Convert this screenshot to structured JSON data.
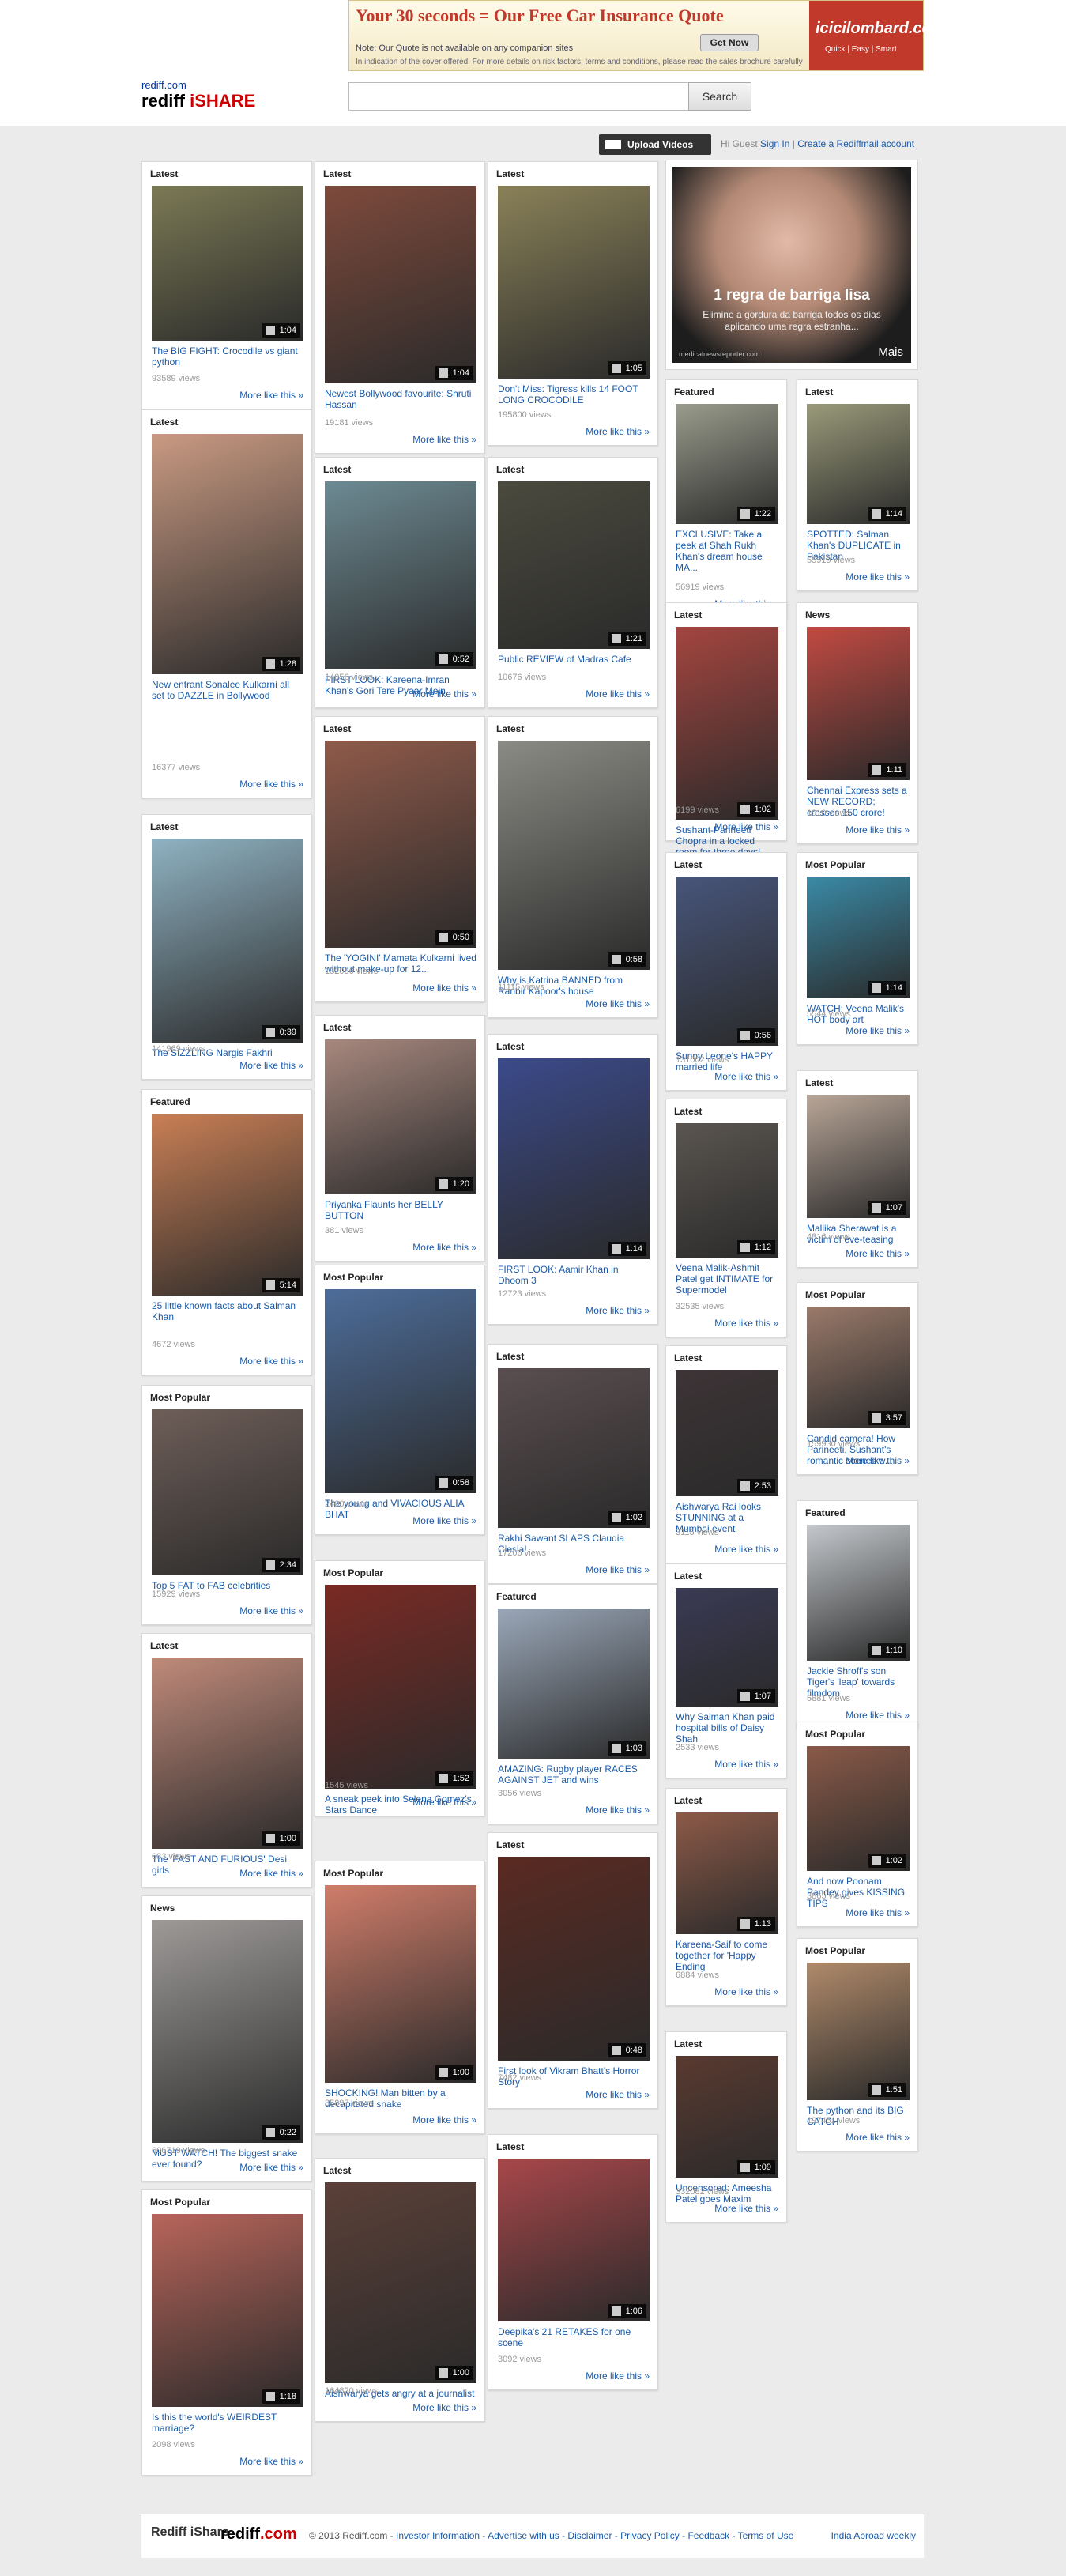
{
  "ad": {
    "title": "Your 30 seconds = Our Free Car Insurance Quote",
    "note": "Note: Our Quote is not available on any companion sites",
    "note2": "In indication of the cover offered. For more details on risk factors, terms and conditions, please read the sales brochure carefully",
    "button": "Get Now",
    "brand": "icicilombard.com",
    "tagline": "Quick | Easy | Smart"
  },
  "header": {
    "logo_small": "rediff.com",
    "logo_big": "rediff",
    "logo_accent": "iSHARE",
    "search_placeholder": "",
    "search_button": "Search",
    "upload_button": "Upload Videos",
    "guest_text": "Hi Guest",
    "sign_in": "Sign In",
    "create_account": "Create a Rediffmail account"
  },
  "side_ad": {
    "headline": "1 regra de barriga lisa",
    "sub": "Elimine a gordura da barriga todos os dias aplicando uma regra estranha...",
    "site": "medicalnewsreporter.com",
    "more": "Mais"
  },
  "more_label": "More like this »",
  "cards": [
    {
      "label": "Latest",
      "title": "The BIG FIGHT: Crocodile vs giant python",
      "views": "93589 views",
      "duration": "1:04",
      "bg": "#7b7a55"
    },
    {
      "label": "Latest",
      "title": "New entrant Sonalee Kulkarni all set to DAZZLE in Bollywood",
      "views": "16377 views",
      "duration": "1:28",
      "bg": "#c99a82"
    },
    {
      "label": "Latest",
      "title": "The SIZZLING Nargis Fakhri",
      "views": "141969 views",
      "duration": "0:39",
      "bg": "#8fb2c2"
    },
    {
      "label": "Featured",
      "title": "25 little known facts about Salman Khan",
      "views": "4672 views",
      "duration": "5:14",
      "bg": "#c97f55"
    },
    {
      "label": "Most Popular",
      "title": "Top 5 FAT to FAB celebrities",
      "views": "15929 views",
      "duration": "2:34",
      "bg": "#6e5e58"
    },
    {
      "label": "Latest",
      "title": "The 'FAST AND FURIOUS' Desi girls",
      "views": "683 views",
      "duration": "1:00",
      "bg": "#c08a7a"
    },
    {
      "label": "News",
      "title": "MUST WATCH! The biggest snake ever found?",
      "views": "606719 views",
      "duration": "0:22",
      "bg": "#9d9a98"
    },
    {
      "label": "Most Popular",
      "title": "Is this the world's WEIRDEST marriage?",
      "views": "2098 views",
      "duration": "1:18",
      "bg": "#b8655a"
    },
    {
      "label": "Latest",
      "title": "Newest Bollywood favourite: Shruti Hassan",
      "views": "19181 views",
      "duration": "1:04",
      "bg": "#7e4a3c"
    },
    {
      "label": "Latest",
      "title": "FIRST LOOK: Kareena-Imran Khan's Gori Tere Pyaar Mein",
      "views": "14056 views",
      "duration": "0:52",
      "bg": "#6d8a93"
    },
    {
      "label": "Latest",
      "title": "The 'YOGINI' Mamata Kulkarni lived without make-up for 12...",
      "views": "132096 views",
      "duration": "0:50",
      "bg": "#8f5a4a"
    },
    {
      "label": "Latest",
      "title": "Priyanka Flaunts her BELLY BUTTON",
      "views": "381 views",
      "duration": "1:20",
      "bg": "#a7887e"
    },
    {
      "label": "Most Popular",
      "title": "The young and VIVACIOUS ALIA BHAT",
      "views": "2400 views",
      "duration": "0:58",
      "bg": "#4d6d9a"
    },
    {
      "label": "Most Popular",
      "title": "A sneak peek into Selena Gomez's Stars Dance",
      "views": "1545 views",
      "duration": "1:52",
      "bg": "#7a2a24"
    },
    {
      "label": "Most Popular",
      "title": "SHOCKING! Man bitten by a decapitated snake",
      "views": "35897 views",
      "duration": "1:00",
      "bg": "#d07d6a"
    },
    {
      "label": "Latest",
      "title": "Aishwarya gets angry at a journalist",
      "views": "164820 views",
      "duration": "1:00",
      "bg": "#5b4038"
    },
    {
      "label": "Latest",
      "title": "Don't Miss: Tigress kills 14 FOOT LONG CROCODILE",
      "views": "195800 views",
      "duration": "1:05",
      "bg": "#8a8158"
    },
    {
      "label": "Latest",
      "title": "Public REVIEW of Madras Cafe",
      "views": "10676 views",
      "duration": "1:21",
      "bg": "#4b4a3e"
    },
    {
      "label": "Latest",
      "title": "Why is Katrina BANNED from Ranbir Kapoor's house",
      "views": "11115 views",
      "duration": "0:58",
      "bg": "#8b8b85"
    },
    {
      "label": "Latest",
      "title": "FIRST LOOK: Aamir Khan in Dhoom 3",
      "views": "12723 views",
      "duration": "1:14",
      "bg": "#3b4a8a"
    },
    {
      "label": "Latest",
      "title": "Rakhi Sawant SLAPS Claudia Ciesla!",
      "views": "17206 views",
      "duration": "1:02",
      "bg": "#5a4e50"
    },
    {
      "label": "Featured",
      "title": "AMAZING: Rugby player RACES AGAINST JET and wins",
      "views": "3056 views",
      "duration": "1:03",
      "bg": "#9aa7b8"
    },
    {
      "label": "Latest",
      "title": "First look of Vikram Bhatt's Horror Story",
      "views": "7482 views",
      "duration": "0:48",
      "bg": "#5a2a22"
    },
    {
      "label": "Latest",
      "title": "Deepika's 21 RETAKES for one scene",
      "views": "3092 views",
      "duration": "1:06",
      "bg": "#a8474a"
    },
    {
      "label": "Featured",
      "title": "EXCLUSIVE: Take a peek at Shah Rukh Khan's dream house MA...",
      "views": "56919 views",
      "duration": "1:22",
      "bg": "#9a9c8c"
    },
    {
      "label": "Latest",
      "title": "Sushant-Parineeti Chopra in a locked room for three days!",
      "views": "6199 views",
      "duration": "1:02",
      "bg": "#a4453f"
    },
    {
      "label": "Latest",
      "title": "Sunny Leone's HAPPY married life",
      "views": "131002 views",
      "duration": "0:56",
      "bg": "#47557a"
    },
    {
      "label": "Latest",
      "title": "Veena Malik-Ashmit Patel get INTIMATE for Supermodel",
      "views": "32535 views",
      "duration": "1:12",
      "bg": "#5a5550"
    },
    {
      "label": "Latest",
      "title": "Aishwarya Rai looks STUNNING at a Mumbai event",
      "views": "3115 views",
      "duration": "2:53",
      "bg": "#3d3436"
    },
    {
      "label": "Latest",
      "title": "Why Salman Khan paid hospital bills of Daisy Shah",
      "views": "2533 views",
      "duration": "1:07",
      "bg": "#3a3a55"
    },
    {
      "label": "Latest",
      "title": "Kareena-Saif to come together for 'Happy Ending'",
      "views": "6884 views",
      "duration": "1:13",
      "bg": "#8d5a48"
    },
    {
      "label": "Latest",
      "title": "Uncensored: Ameesha Patel goes Maxim",
      "views": "332082 views",
      "duration": "1:09",
      "bg": "#5a3a30"
    },
    {
      "label": "Latest",
      "title": "SPOTTED: Salman Khan's DUPLICATE in Pakistan",
      "views": "55919 views",
      "duration": "1:14",
      "bg": "#9a9a7a"
    },
    {
      "label": "News",
      "title": "Chennai Express sets a NEW RECORD; crosses 150 crore!",
      "views": "1910 views",
      "duration": "1:11",
      "bg": "#c24a42"
    },
    {
      "label": "Most Popular",
      "title": "WATCH: Veena Malik's HOT body art",
      "views": "5544 views",
      "duration": "1:14",
      "bg": "#3a8aa6"
    },
    {
      "label": "Latest",
      "title": "Mallika Sherawat is a victim of eve-teasing",
      "views": "4316 views",
      "duration": "1:07",
      "bg": "#b9a698"
    },
    {
      "label": "Most Popular",
      "title": "Candid camera! How Parineeti, Sushant's romantic scenes w...",
      "views": "159930 views",
      "duration": "3:57",
      "bg": "#9a7a6a"
    },
    {
      "label": "Featured",
      "title": "Jackie Shroff's son Tiger's 'leap' towards filmdom",
      "views": "5881 views",
      "duration": "1:10",
      "bg": "#c4c8cc"
    },
    {
      "label": "Most Popular",
      "title": "And now Poonam Pandey gives KISSING TIPS",
      "views": "3865 views",
      "duration": "1:02",
      "bg": "#8a5a48"
    },
    {
      "label": "Most Popular",
      "title": "The python and its BIG CATCH",
      "views": "197451 views",
      "duration": "1:51",
      "bg": "#b08a6a"
    }
  ],
  "footer": {
    "logo1": "Rediff iShare",
    "logo2": "rediff",
    "copyright": "© 2013 Rediff.com",
    "links": "Investor Information - Advertise with us - Disclaimer - Privacy Policy - Feedback - Terms of Use",
    "weekly": "India Abroad weekly"
  }
}
